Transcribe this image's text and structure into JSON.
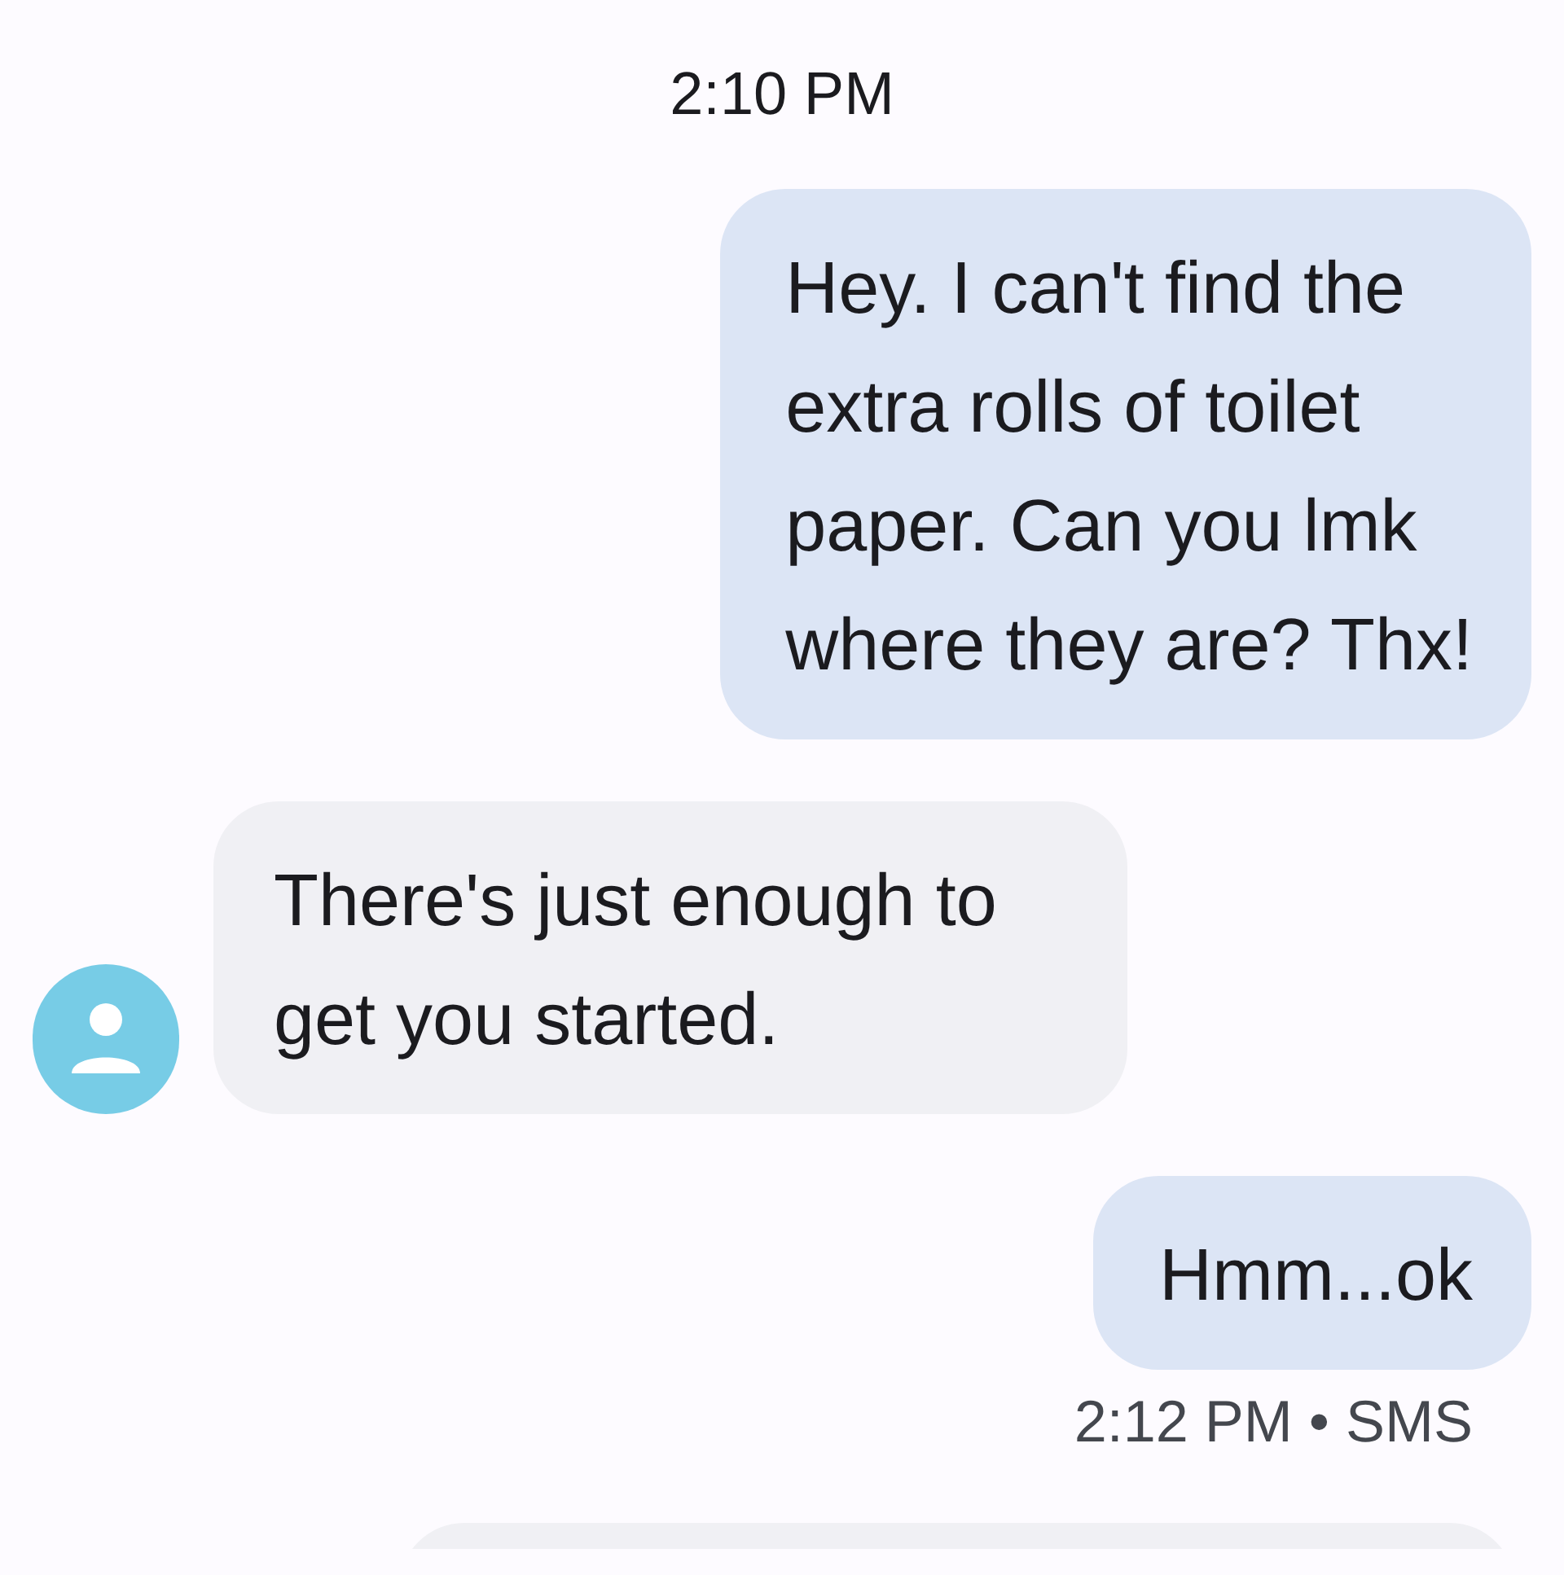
{
  "timestamp": "2:10 PM",
  "messages": [
    {
      "kind": "outgoing",
      "lines": [
        "Hey. I can't find the",
        "extra rolls of toilet",
        "paper. Can you lmk",
        "where they are? Thx!"
      ]
    },
    {
      "kind": "incoming",
      "lines": [
        "There's just enough to",
        "get you started."
      ]
    },
    {
      "kind": "outgoing",
      "lines": [
        "Hmm...ok"
      ],
      "meta": "2:12 PM • SMS"
    },
    {
      "kind": "partial"
    }
  ]
}
